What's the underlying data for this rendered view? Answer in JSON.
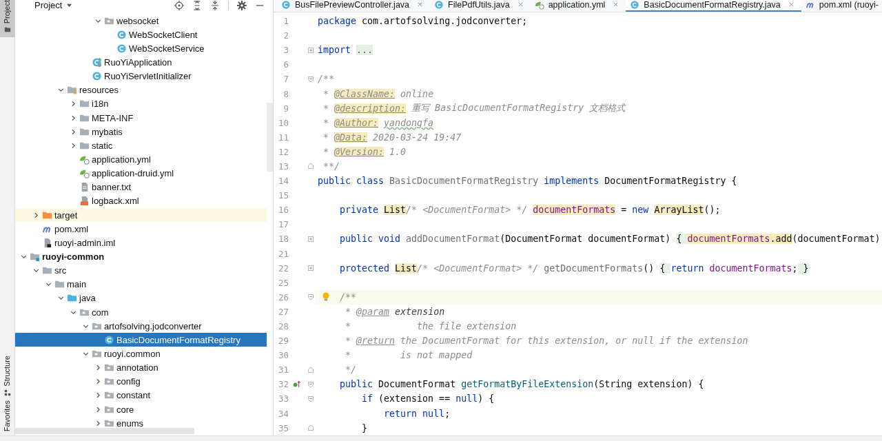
{
  "tool_strip": {
    "top": [
      {
        "label": "Project",
        "selected": true
      }
    ],
    "bottom": [
      {
        "label": "Structure",
        "selected": false
      },
      {
        "label": "Favorites",
        "selected": false
      }
    ]
  },
  "project_panel": {
    "title": "Project"
  },
  "tree": [
    {
      "children": [
        {
          "children": [
            {
              "children": [
                {
                  "children": [
                    {
                      "children": [
                        {
                          "children": [
                            {
                              "label": "websocket",
                              "kind": "package",
                              "expanded": true,
                              "selected": false,
                              "children": [
                                {
                                  "label": "WebSocketClient",
                                  "kind": "class",
                                  "selected": false
                                },
                                {
                                  "label": "WebSocketService",
                                  "kind": "class",
                                  "selected": false
                                }
                              ]
                            }
                          ]
                        },
                        {
                          "label": "RuoYiApplication",
                          "kind": "spring-class",
                          "selected": false
                        },
                        {
                          "label": "RuoYiServletInitializer",
                          "kind": "class",
                          "selected": false
                        }
                      ]
                    }
                  ]
                },
                {
                  "label": "resources",
                  "kind": "resources",
                  "expanded": true,
                  "selected": false,
                  "children": [
                    {
                      "label": "i18n",
                      "kind": "folder",
                      "expanded": false,
                      "selected": false
                    },
                    {
                      "label": "META-INF",
                      "kind": "folder",
                      "expanded": false,
                      "selected": false
                    },
                    {
                      "label": "mybatis",
                      "kind": "folder",
                      "expanded": false,
                      "selected": false
                    },
                    {
                      "label": "static",
                      "kind": "folder",
                      "expanded": false,
                      "selected": false
                    },
                    {
                      "label": "application.yml",
                      "kind": "yml",
                      "selected": false
                    },
                    {
                      "label": "application-druid.yml",
                      "kind": "yml",
                      "selected": false
                    },
                    {
                      "label": "banner.txt",
                      "kind": "text",
                      "selected": false
                    },
                    {
                      "label": "logback.xml",
                      "kind": "xml",
                      "selected": false
                    }
                  ]
                }
              ]
            }
          ]
        },
        {
          "label": "target",
          "kind": "excluded",
          "expanded": false,
          "selected": false
        },
        {
          "label": "pom.xml",
          "kind": "maven",
          "selected": false
        },
        {
          "label": "ruoyi-admin.iml",
          "kind": "iml",
          "selected": false
        }
      ]
    },
    {
      "label": "ruoyi-common",
      "kind": "module",
      "bold": true,
      "expanded": true,
      "selected": false,
      "children": [
        {
          "label": "src",
          "kind": "folder",
          "expanded": true,
          "selected": false,
          "children": [
            {
              "label": "main",
              "kind": "folder",
              "expanded": true,
              "selected": false,
              "children": [
                {
                  "label": "java",
                  "kind": "source",
                  "expanded": true,
                  "selected": false,
                  "children": [
                    {
                      "label": "com",
                      "kind": "package",
                      "expanded": true,
                      "selected": false,
                      "children": [
                        {
                          "label": "artofsolving.jodconverter",
                          "kind": "package",
                          "expanded": true,
                          "selected": false,
                          "children": [
                            {
                              "label": "BasicDocumentFormatRegistry",
                              "kind": "class",
                              "selected": true
                            }
                          ]
                        },
                        {
                          "label": "ruoyi.common",
                          "kind": "package",
                          "expanded": true,
                          "selected": false,
                          "children": [
                            {
                              "label": "annotation",
                              "kind": "package",
                              "expanded": false,
                              "selected": false
                            },
                            {
                              "label": "config",
                              "kind": "package",
                              "expanded": false,
                              "selected": false
                            },
                            {
                              "label": "constant",
                              "kind": "package",
                              "expanded": false,
                              "selected": false
                            },
                            {
                              "label": "core",
                              "kind": "package",
                              "expanded": false,
                              "selected": false
                            },
                            {
                              "label": "enums",
                              "kind": "package",
                              "expanded": false,
                              "selected": false
                            }
                          ]
                        }
                      ]
                    }
                  ]
                }
              ]
            }
          ]
        }
      ]
    }
  ],
  "tabs": [
    {
      "label": "BusFilePreviewController.java",
      "kind": "class",
      "selected": false,
      "closable": true
    },
    {
      "label": "FilePdfUtils.java",
      "kind": "class",
      "selected": false,
      "closable": true
    },
    {
      "label": "application.yml",
      "kind": "yml",
      "selected": false,
      "closable": true
    },
    {
      "label": "BasicDocumentFormatRegistry.java",
      "kind": "class",
      "selected": true,
      "closable": true
    },
    {
      "label": "pom.xml (ruoyi-",
      "kind": "maven",
      "selected": false,
      "closable": false
    }
  ],
  "code": [
    {
      "n": "1",
      "tokens": [
        {
          "kind": "kw",
          "text": "package"
        },
        {
          "kind": "plain",
          "text": " com.artofsolving.jodconverter;"
        }
      ]
    },
    {
      "n": "2"
    },
    {
      "n": "3",
      "fold": {
        "kind": "closed"
      },
      "tokens": [
        {
          "kind": "kw",
          "text": "import "
        },
        {
          "kind": "folded",
          "text": "..."
        }
      ]
    },
    {
      "n": "6"
    },
    {
      "n": "7",
      "fold": {
        "kind": "open"
      },
      "tokens": [
        {
          "kind": "doc",
          "text": "/**"
        }
      ]
    },
    {
      "n": "8",
      "tokens": [
        {
          "kind": "doc",
          "text": " * "
        },
        {
          "kind": "doctag-warn",
          "text": "@ClassName:"
        },
        {
          "kind": "doc",
          "text": " online"
        }
      ]
    },
    {
      "n": "9",
      "tokens": [
        {
          "kind": "doc",
          "text": " * "
        },
        {
          "kind": "doctag-warn",
          "text": "@description:"
        },
        {
          "kind": "doc",
          "text": " 重写 BasicDocumentFormatRegistry 文档格式"
        }
      ]
    },
    {
      "n": "10",
      "tokens": [
        {
          "kind": "doc",
          "text": " * "
        },
        {
          "kind": "doctag-warn",
          "text": "@Author:"
        },
        {
          "kind": "doc-typo",
          "text": "yandongfa"
        }
      ]
    },
    {
      "n": "11",
      "tokens": [
        {
          "kind": "doc",
          "text": " * "
        },
        {
          "kind": "doctag-warn",
          "text": "@Data:"
        },
        {
          "kind": "doc",
          "text": " 2020-03-24 19:47"
        }
      ]
    },
    {
      "n": "12",
      "tokens": [
        {
          "kind": "doc",
          "text": " * "
        },
        {
          "kind": "doctag-warn",
          "text": "@Version:"
        },
        {
          "kind": "doc",
          "text": " 1.0"
        }
      ]
    },
    {
      "n": "13",
      "fold": {
        "kind": "end"
      },
      "tokens": [
        {
          "kind": "doc",
          "text": " **/"
        }
      ]
    },
    {
      "n": "14",
      "tokens": [
        {
          "kind": "kw",
          "text": "public class "
        },
        {
          "kind": "muted",
          "text": "BasicDocumentFormatRegistry "
        },
        {
          "kind": "kw",
          "text": "implements "
        },
        {
          "kind": "plain",
          "text": "DocumentFormatRegistry {"
        }
      ]
    },
    {
      "n": "15"
    },
    {
      "n": "16",
      "tokens": [
        {
          "kind": "kw",
          "text": "    private "
        },
        {
          "kind": "plain-warn",
          "text": "List"
        },
        {
          "kind": "doc",
          "text": "/* <DocumentFormat> */ "
        },
        {
          "kind": "field-warn",
          "text": "documentFormats"
        },
        {
          "kind": "plain",
          "text": " = "
        },
        {
          "kind": "kw",
          "text": "new "
        },
        {
          "kind": "plain-warn",
          "text": "ArrayList"
        },
        {
          "kind": "plain",
          "text": "();"
        }
      ]
    },
    {
      "n": "17"
    },
    {
      "n": "18",
      "fold": {
        "kind": "closed"
      },
      "tokens": [
        {
          "kind": "kw",
          "text": "    public void "
        },
        {
          "kind": "muted",
          "text": "addDocumentFormat"
        },
        {
          "kind": "plain",
          "text": "(DocumentFormat documentFormat) "
        },
        {
          "kind": "fold-brace",
          "text": "{ "
        },
        {
          "kind": "field-warn",
          "text": "documentFormats"
        },
        {
          "kind": "plain-warn",
          "text": ".add"
        },
        {
          "kind": "plain",
          "text": "(documentFormat)"
        }
      ]
    },
    {
      "n": "21"
    },
    {
      "n": "22",
      "fold": {
        "kind": "closed"
      },
      "tokens": [
        {
          "kind": "kw",
          "text": "    protected "
        },
        {
          "kind": "plain-warn",
          "text": "List"
        },
        {
          "kind": "doc",
          "text": "/* <DocumentFormat> */ "
        },
        {
          "kind": "muted",
          "text": "getDocumentFormats"
        },
        {
          "kind": "plain",
          "text": "() "
        },
        {
          "kind": "fold-brace",
          "text": "{ "
        },
        {
          "kind": "kw",
          "text": "return "
        },
        {
          "kind": "field",
          "text": "documentFormats"
        },
        {
          "kind": "plain",
          "text": ";"
        },
        {
          "kind": "fold-brace",
          "text": " }"
        }
      ]
    },
    {
      "n": "25"
    },
    {
      "n": "26",
      "current": true,
      "marker": {
        "kind": "bulb"
      },
      "fold": {
        "kind": "open"
      },
      "tokens": [
        {
          "kind": "doc",
          "text": "    /**"
        }
      ]
    },
    {
      "n": "27",
      "tokens": [
        {
          "kind": "doc",
          "text": "     * "
        },
        {
          "kind": "doctag",
          "text": "@param"
        },
        {
          "kind": "docparam",
          "text": " extension"
        }
      ]
    },
    {
      "n": "28",
      "tokens": [
        {
          "kind": "doc",
          "text": "     *            the file extension"
        }
      ]
    },
    {
      "n": "29",
      "tokens": [
        {
          "kind": "doc",
          "text": "     * "
        },
        {
          "kind": "doctag",
          "text": "@return"
        },
        {
          "kind": "doc",
          "text": " the DocumentFormat for this extension, or null if the extension"
        }
      ]
    },
    {
      "n": "30",
      "tokens": [
        {
          "kind": "doc",
          "text": "     *         is not mapped"
        }
      ]
    },
    {
      "n": "31",
      "fold": {
        "kind": "end"
      },
      "tokens": [
        {
          "kind": "doc",
          "text": "     */"
        }
      ]
    },
    {
      "n": "32",
      "marker": {
        "kind": "override"
      },
      "fold": {
        "kind": "open"
      },
      "tokens": [
        {
          "kind": "kw",
          "text": "    public "
        },
        {
          "kind": "plain",
          "text": "DocumentFormat "
        },
        {
          "kind": "method",
          "text": "getFormatByFileExtension"
        },
        {
          "kind": "plain",
          "text": "(String extension) {"
        }
      ]
    },
    {
      "n": "33",
      "fold": {
        "kind": "open"
      },
      "tokens": [
        {
          "kind": "kw",
          "text": "        if "
        },
        {
          "kind": "plain",
          "text": "(extension == "
        },
        {
          "kind": "kw",
          "text": "null"
        },
        {
          "kind": "plain",
          "text": ") {"
        }
      ]
    },
    {
      "n": "34",
      "tokens": [
        {
          "kind": "kw",
          "text": "            return null"
        },
        {
          "kind": "plain",
          "text": ";"
        }
      ]
    },
    {
      "n": "35",
      "fold": {
        "kind": "end"
      },
      "tokens": [
        {
          "kind": "plain",
          "text": "        }"
        }
      ]
    }
  ]
}
